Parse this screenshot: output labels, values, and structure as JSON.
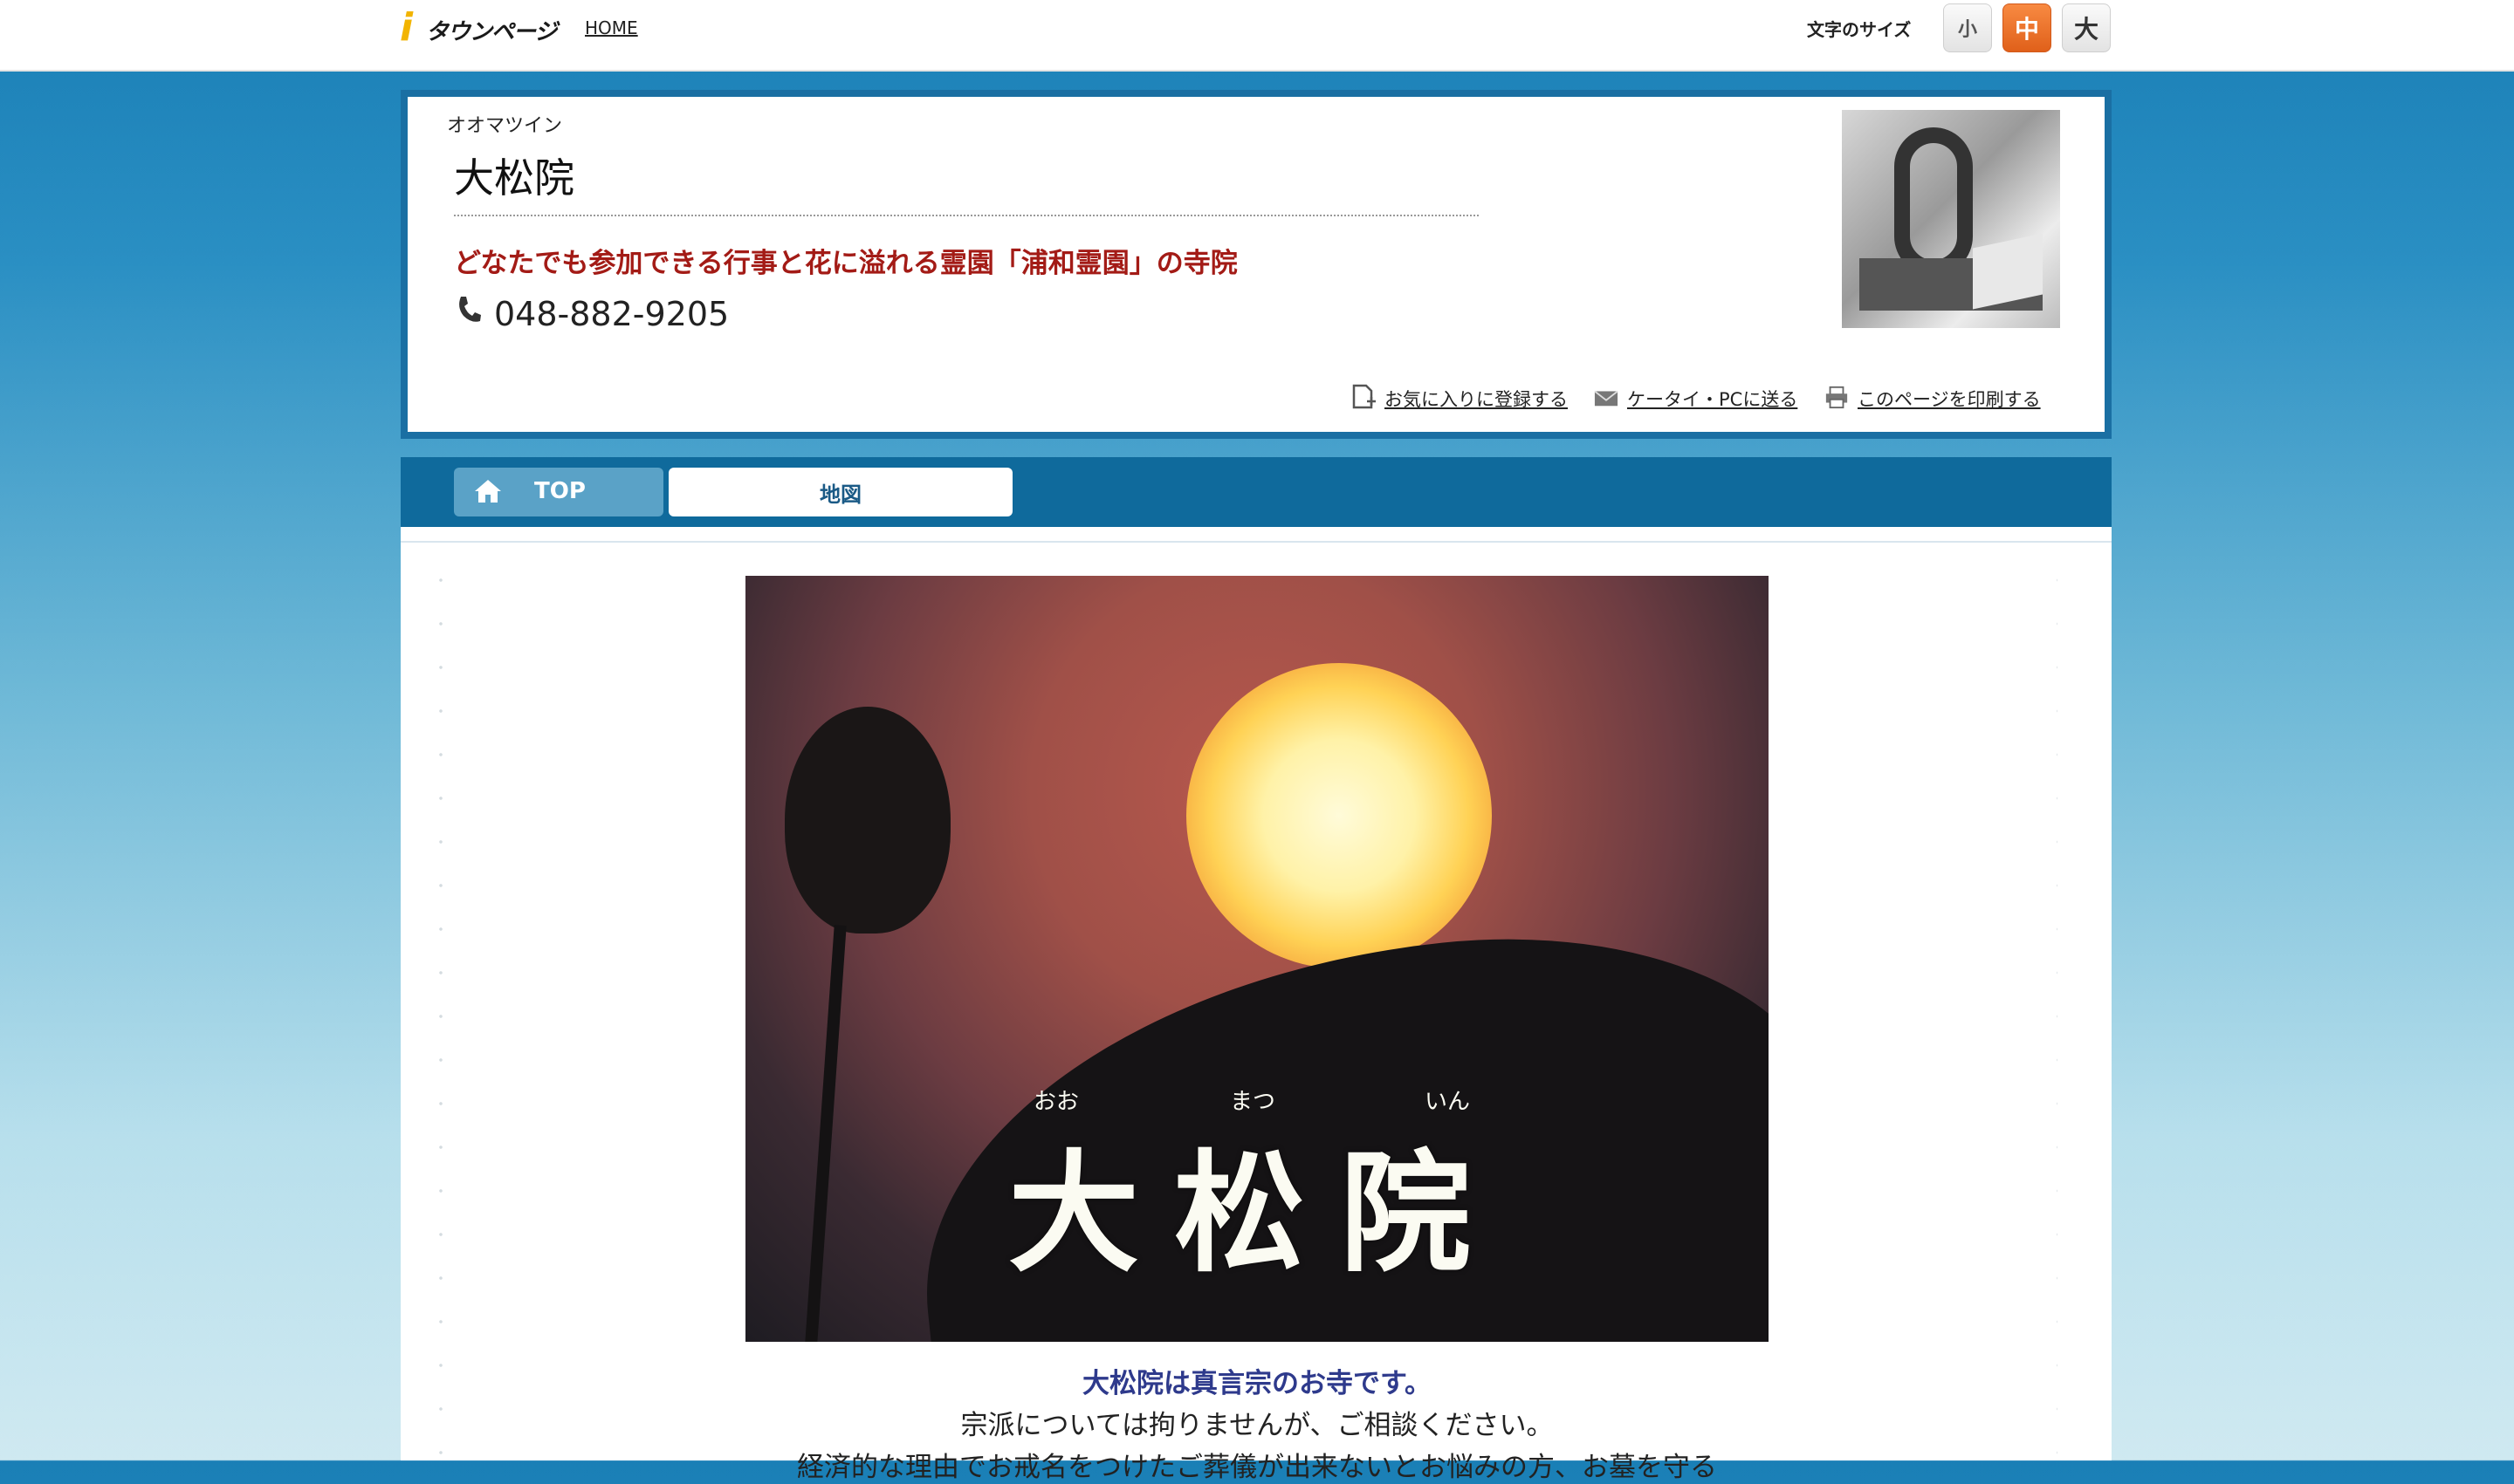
{
  "topbar": {
    "logo_text": "タウンページ",
    "home_label": "HOME",
    "font_size_label": "文字のサイズ",
    "font_sizes": {
      "small": "小",
      "medium": "中",
      "large": "大"
    }
  },
  "header": {
    "kana": "オオマツイン",
    "name": "大松院",
    "catchphrase": "どなたでも参加できる行事と花に溢れる霊園「浦和霊園」の寺院",
    "phone": "048-882-9205",
    "actions": {
      "favorite": "お気に入りに登録する",
      "send": "ケータイ・PCに送る",
      "print": "このページを印刷する"
    }
  },
  "nav": {
    "tabs": [
      {
        "label": "TOP",
        "icon": "home-icon"
      },
      {
        "label": "地図"
      }
    ]
  },
  "hero": {
    "title": "大松院",
    "ruby": [
      "おお",
      "まつ",
      "いん"
    ]
  },
  "intro": {
    "line1": "大松院は真言宗のお寺です。",
    "line2": "宗派については拘りませんが、ご相談ください。",
    "line3": "経済的な理由でお戒名をつけたご葬儀が出来ないとお悩みの方、お墓を守る"
  },
  "colors": {
    "accent": "#0f6a9c",
    "catch": "#a31b16",
    "intro_accent": "#2e3a8c",
    "font_size_active": "#e0601a"
  }
}
